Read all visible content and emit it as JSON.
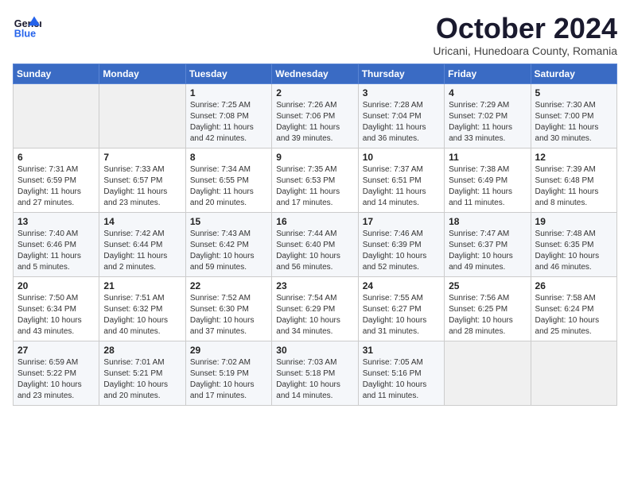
{
  "logo": {
    "line1": "General",
    "line2": "Blue"
  },
  "title": "October 2024",
  "subtitle": "Uricani, Hunedoara County, Romania",
  "days_header": [
    "Sunday",
    "Monday",
    "Tuesday",
    "Wednesday",
    "Thursday",
    "Friday",
    "Saturday"
  ],
  "weeks": [
    [
      {
        "num": "",
        "sunrise": "",
        "sunset": "",
        "daylight": ""
      },
      {
        "num": "",
        "sunrise": "",
        "sunset": "",
        "daylight": ""
      },
      {
        "num": "1",
        "sunrise": "Sunrise: 7:25 AM",
        "sunset": "Sunset: 7:08 PM",
        "daylight": "Daylight: 11 hours and 42 minutes."
      },
      {
        "num": "2",
        "sunrise": "Sunrise: 7:26 AM",
        "sunset": "Sunset: 7:06 PM",
        "daylight": "Daylight: 11 hours and 39 minutes."
      },
      {
        "num": "3",
        "sunrise": "Sunrise: 7:28 AM",
        "sunset": "Sunset: 7:04 PM",
        "daylight": "Daylight: 11 hours and 36 minutes."
      },
      {
        "num": "4",
        "sunrise": "Sunrise: 7:29 AM",
        "sunset": "Sunset: 7:02 PM",
        "daylight": "Daylight: 11 hours and 33 minutes."
      },
      {
        "num": "5",
        "sunrise": "Sunrise: 7:30 AM",
        "sunset": "Sunset: 7:00 PM",
        "daylight": "Daylight: 11 hours and 30 minutes."
      }
    ],
    [
      {
        "num": "6",
        "sunrise": "Sunrise: 7:31 AM",
        "sunset": "Sunset: 6:59 PM",
        "daylight": "Daylight: 11 hours and 27 minutes."
      },
      {
        "num": "7",
        "sunrise": "Sunrise: 7:33 AM",
        "sunset": "Sunset: 6:57 PM",
        "daylight": "Daylight: 11 hours and 23 minutes."
      },
      {
        "num": "8",
        "sunrise": "Sunrise: 7:34 AM",
        "sunset": "Sunset: 6:55 PM",
        "daylight": "Daylight: 11 hours and 20 minutes."
      },
      {
        "num": "9",
        "sunrise": "Sunrise: 7:35 AM",
        "sunset": "Sunset: 6:53 PM",
        "daylight": "Daylight: 11 hours and 17 minutes."
      },
      {
        "num": "10",
        "sunrise": "Sunrise: 7:37 AM",
        "sunset": "Sunset: 6:51 PM",
        "daylight": "Daylight: 11 hours and 14 minutes."
      },
      {
        "num": "11",
        "sunrise": "Sunrise: 7:38 AM",
        "sunset": "Sunset: 6:49 PM",
        "daylight": "Daylight: 11 hours and 11 minutes."
      },
      {
        "num": "12",
        "sunrise": "Sunrise: 7:39 AM",
        "sunset": "Sunset: 6:48 PM",
        "daylight": "Daylight: 11 hours and 8 minutes."
      }
    ],
    [
      {
        "num": "13",
        "sunrise": "Sunrise: 7:40 AM",
        "sunset": "Sunset: 6:46 PM",
        "daylight": "Daylight: 11 hours and 5 minutes."
      },
      {
        "num": "14",
        "sunrise": "Sunrise: 7:42 AM",
        "sunset": "Sunset: 6:44 PM",
        "daylight": "Daylight: 11 hours and 2 minutes."
      },
      {
        "num": "15",
        "sunrise": "Sunrise: 7:43 AM",
        "sunset": "Sunset: 6:42 PM",
        "daylight": "Daylight: 10 hours and 59 minutes."
      },
      {
        "num": "16",
        "sunrise": "Sunrise: 7:44 AM",
        "sunset": "Sunset: 6:40 PM",
        "daylight": "Daylight: 10 hours and 56 minutes."
      },
      {
        "num": "17",
        "sunrise": "Sunrise: 7:46 AM",
        "sunset": "Sunset: 6:39 PM",
        "daylight": "Daylight: 10 hours and 52 minutes."
      },
      {
        "num": "18",
        "sunrise": "Sunrise: 7:47 AM",
        "sunset": "Sunset: 6:37 PM",
        "daylight": "Daylight: 10 hours and 49 minutes."
      },
      {
        "num": "19",
        "sunrise": "Sunrise: 7:48 AM",
        "sunset": "Sunset: 6:35 PM",
        "daylight": "Daylight: 10 hours and 46 minutes."
      }
    ],
    [
      {
        "num": "20",
        "sunrise": "Sunrise: 7:50 AM",
        "sunset": "Sunset: 6:34 PM",
        "daylight": "Daylight: 10 hours and 43 minutes."
      },
      {
        "num": "21",
        "sunrise": "Sunrise: 7:51 AM",
        "sunset": "Sunset: 6:32 PM",
        "daylight": "Daylight: 10 hours and 40 minutes."
      },
      {
        "num": "22",
        "sunrise": "Sunrise: 7:52 AM",
        "sunset": "Sunset: 6:30 PM",
        "daylight": "Daylight: 10 hours and 37 minutes."
      },
      {
        "num": "23",
        "sunrise": "Sunrise: 7:54 AM",
        "sunset": "Sunset: 6:29 PM",
        "daylight": "Daylight: 10 hours and 34 minutes."
      },
      {
        "num": "24",
        "sunrise": "Sunrise: 7:55 AM",
        "sunset": "Sunset: 6:27 PM",
        "daylight": "Daylight: 10 hours and 31 minutes."
      },
      {
        "num": "25",
        "sunrise": "Sunrise: 7:56 AM",
        "sunset": "Sunset: 6:25 PM",
        "daylight": "Daylight: 10 hours and 28 minutes."
      },
      {
        "num": "26",
        "sunrise": "Sunrise: 7:58 AM",
        "sunset": "Sunset: 6:24 PM",
        "daylight": "Daylight: 10 hours and 25 minutes."
      }
    ],
    [
      {
        "num": "27",
        "sunrise": "Sunrise: 6:59 AM",
        "sunset": "Sunset: 5:22 PM",
        "daylight": "Daylight: 10 hours and 23 minutes."
      },
      {
        "num": "28",
        "sunrise": "Sunrise: 7:01 AM",
        "sunset": "Sunset: 5:21 PM",
        "daylight": "Daylight: 10 hours and 20 minutes."
      },
      {
        "num": "29",
        "sunrise": "Sunrise: 7:02 AM",
        "sunset": "Sunset: 5:19 PM",
        "daylight": "Daylight: 10 hours and 17 minutes."
      },
      {
        "num": "30",
        "sunrise": "Sunrise: 7:03 AM",
        "sunset": "Sunset: 5:18 PM",
        "daylight": "Daylight: 10 hours and 14 minutes."
      },
      {
        "num": "31",
        "sunrise": "Sunrise: 7:05 AM",
        "sunset": "Sunset: 5:16 PM",
        "daylight": "Daylight: 10 hours and 11 minutes."
      },
      {
        "num": "",
        "sunrise": "",
        "sunset": "",
        "daylight": ""
      },
      {
        "num": "",
        "sunrise": "",
        "sunset": "",
        "daylight": ""
      }
    ]
  ]
}
